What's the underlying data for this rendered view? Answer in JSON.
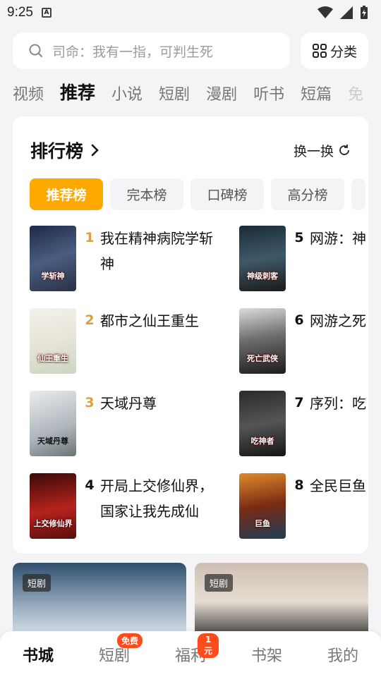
{
  "status": {
    "time": "9:25",
    "app_icon": "A"
  },
  "search": {
    "placeholder": "司命：我有一指，可判生死",
    "category_label": "分类"
  },
  "tabs": [
    "视频",
    "推荐",
    "小说",
    "短剧",
    "漫剧",
    "听书",
    "短篇",
    "免"
  ],
  "active_tab": "推荐",
  "ranking": {
    "title": "排行榜",
    "refresh_label": "换一换",
    "chips": [
      "推荐榜",
      "完本榜",
      "口碑榜",
      "高分榜",
      ""
    ],
    "books": [
      {
        "rank": "1",
        "title": "我在精神病院学斩神",
        "cover_text": "学斩神"
      },
      {
        "rank": "2",
        "title": "都市之仙王重生",
        "cover_text": "仙王重生"
      },
      {
        "rank": "3",
        "title": "天域丹尊",
        "cover_text": "天域丹尊"
      },
      {
        "rank": "4",
        "title": "开局上交修仙界，国家让我先成仙",
        "cover_text": "上交修仙界"
      },
      {
        "rank": "5",
        "title": "网游：神级刺客，我即是暗影",
        "cover_text": "神级刺客"
      },
      {
        "rank": "6",
        "title": "网游之死亡武侠",
        "cover_text": "死亡武侠"
      },
      {
        "rank": "7",
        "title": "序列：吃神者",
        "cover_text": "吃神者"
      },
      {
        "rank": "8",
        "title": "全民巨鱼：我能听到巨鱼心声",
        "cover_text": "巨鱼"
      }
    ],
    "visible_titles": [
      "我在精神病院学斩神",
      "都市之仙王重生",
      "天域丹尊",
      "开局上交修仙界，国家让我先成仙",
      "网游：神",
      "网游之死",
      "序列：吃",
      "全民巨鱼"
    ]
  },
  "promos": [
    {
      "tag": "短剧"
    },
    {
      "tag": "短剧"
    }
  ],
  "bottom_nav": [
    {
      "label": "书城",
      "badge": ""
    },
    {
      "label": "短剧",
      "badge": "免费"
    },
    {
      "label": "福利",
      "badge": "1元"
    },
    {
      "label": "书架",
      "badge": ""
    },
    {
      "label": "我的",
      "badge": ""
    }
  ],
  "colors": {
    "accent": "#ffa800",
    "rank_gold": "#d9a23e",
    "badge": "#ff4a1c"
  }
}
